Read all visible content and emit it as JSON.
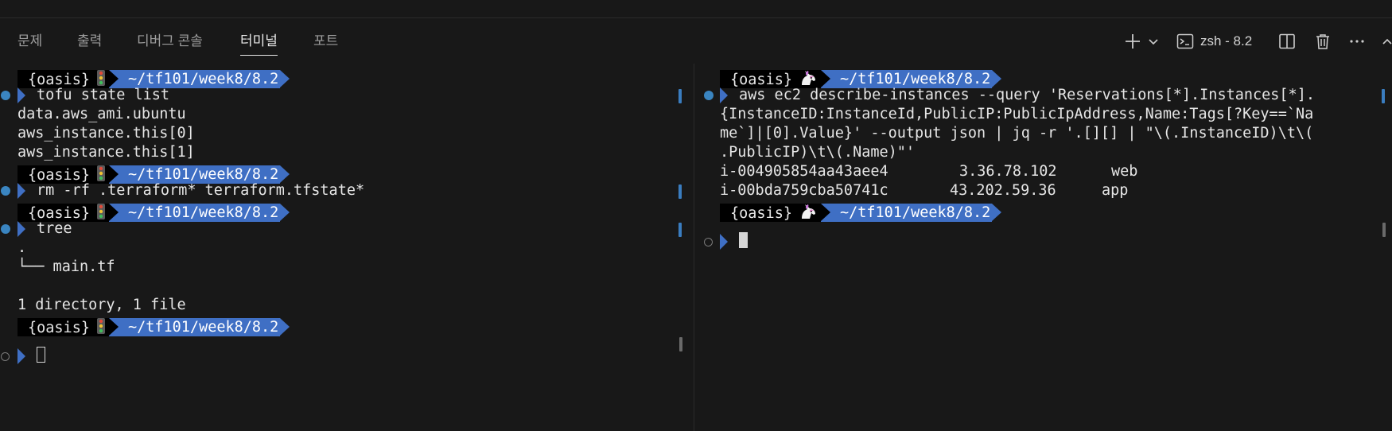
{
  "tabs": [
    {
      "label": "문제"
    },
    {
      "label": "출력"
    },
    {
      "label": "디버그 콘솔"
    },
    {
      "label": "터미널"
    },
    {
      "label": "포트"
    }
  ],
  "active_tab": "터미널",
  "terminal_selector": {
    "label": "zsh - 8.2"
  },
  "icons": {
    "new_terminal": "plus-icon",
    "new_terminal_menu": "chevron-down-icon",
    "terminal_kind": "terminal-icon",
    "split": "split-terminal-icon",
    "kill": "trash-icon",
    "more": "ellipsis-icon",
    "maximize": "chevron-up-icon",
    "prompt_emoji_left": "traffic-light-icon",
    "prompt_emoji_right": "unicorn-icon"
  },
  "colors": {
    "background": "#181818",
    "prompt_path_bg": "#3f6fc4",
    "prompt_host_bg": "#000000",
    "decoration_success": "#3a85c1"
  },
  "left_terminal": {
    "host": "{oasis}",
    "path": "~/tf101/week8/8.2",
    "commands": [
      "tofu state list",
      "rm -rf .terraform* terraform.tfstate*",
      "tree"
    ],
    "output_state_list": [
      "data.aws_ami.ubuntu",
      "aws_instance.this[0]",
      "aws_instance.this[1]"
    ],
    "tree_root": ".",
    "tree_entry": "└── main.tf",
    "tree_summary": "1 directory, 1 file"
  },
  "right_terminal": {
    "host": "{oasis}",
    "path": "~/tf101/week8/8.2",
    "command_lines": [
      "aws ec2 describe-instances --query 'Reservations[*].Instances[*].",
      "{InstanceID:InstanceId,PublicIP:PublicIpAddress,Name:Tags[?Key==`Na",
      "me`]|[0].Value}' --output json | jq -r '.[][] | \"\\(.InstanceID)\\t\\(",
      ".PublicIP)\\t\\(.Name)\"'"
    ],
    "instances": [
      {
        "id": "i-004905854aa43aee4",
        "ip": "3.36.78.102",
        "name": "web"
      },
      {
        "id": "i-00bda759cba50741c",
        "ip": "43.202.59.36",
        "name": "app"
      }
    ]
  }
}
